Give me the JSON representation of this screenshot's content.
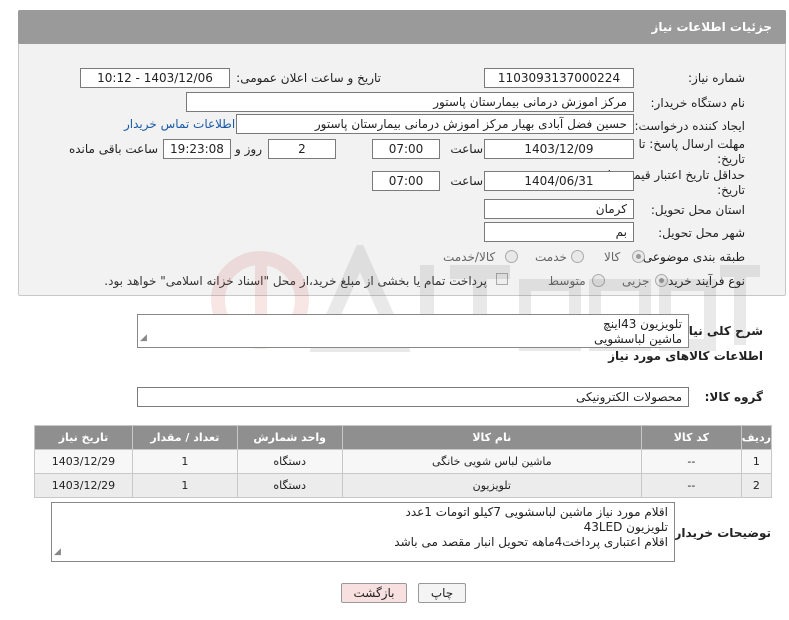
{
  "header": {
    "title": "جزئیات اطلاعات نیاز"
  },
  "form": {
    "need_number_label": "شماره نیاز:",
    "need_number": "1103093137000224",
    "announce_label": "تاریخ و ساعت اعلان عمومی:",
    "announce_value": "1403/12/06 - 10:12",
    "buyer_org_label": "نام دستگاه خریدار:",
    "buyer_org": "مرکز اموزش درمانی بیمارستان پاستور",
    "creator_label": "ایجاد کننده درخواست:",
    "creator": "حسین فضل آبادی بهیار مرکز اموزش درمانی بیمارستان پاستور",
    "contact_link": "اطلاعات تماس خریدار",
    "reply_deadline_label_1": "مهلت ارسال پاسخ: تا",
    "reply_deadline_label_2": "تاریخ:",
    "reply_date": "1403/12/09",
    "time_label": "ساعت",
    "reply_time": "07:00",
    "days_value": "2",
    "days_label": "روز و",
    "remaining_time": "19:23:08",
    "remaining_label": "ساعت باقی مانده",
    "price_validity_label_1": "حداقل تاریخ اعتبار قیمت: تا",
    "price_validity_label_2": "تاریخ:",
    "price_date": "1404/06/31",
    "price_time": "07:00",
    "province_label": "استان محل تحویل:",
    "province": "کرمان",
    "city_label": "شهر محل تحویل:",
    "city": "بم",
    "category_label": "طبقه بندی موضوعی:",
    "category_options": [
      "کالا",
      "خدمت",
      "کالا/خدمت"
    ],
    "category_selected": 0,
    "process_label": "نوع فرآیند خرید :",
    "process_options": [
      "جزیی",
      "متوسط"
    ],
    "process_selected": 0,
    "payment_note": "پرداخت تمام یا بخشی از مبلغ خرید،از محل \"اسناد خزانه اسلامی\" خواهد بود."
  },
  "description": {
    "label": "شرح کلی نیاز:",
    "lines": [
      "تلویزیون 43اینچ",
      "ماشین لباسشویی"
    ]
  },
  "items_section": {
    "title": "اطلاعات کالاهای مورد نیاز",
    "group_label": "گروه کالا:",
    "group_value": "محصولات الکترونیکی",
    "columns": [
      "ردیف",
      "کد کالا",
      "نام کالا",
      "واحد شمارش",
      "تعداد / مقدار",
      "تاریخ نیاز"
    ],
    "rows": [
      [
        "1",
        "--",
        "ماشین لباس شویی خانگی",
        "دستگاه",
        "1",
        "1403/12/29"
      ],
      [
        "2",
        "--",
        "تلویزیون",
        "دستگاه",
        "1",
        "1403/12/29"
      ]
    ]
  },
  "buyer_notes": {
    "label": "توضیحات خریدار:",
    "lines": [
      "اقلام مورد نیاز ماشین لباسشویی 7کیلو اتومات 1عدد",
      "تلویزیون 43LED",
      "اقلام اعتباری پرداخت4ماهه تحویل انبار مقصد می باشد"
    ]
  },
  "buttons": {
    "print": "چاپ",
    "back": "بازگشت"
  },
  "colors": {
    "header_bg": "#9a9a9a",
    "link": "#1a5aa8",
    "back_button_bg": "#f9e0e0"
  }
}
